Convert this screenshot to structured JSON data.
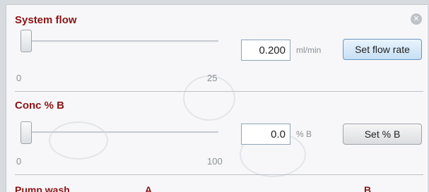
{
  "system_flow": {
    "title": "System flow",
    "value": "0.200",
    "unit": "ml/min",
    "button_label": "Set flow rate",
    "slider_min": "0",
    "slider_max": "25",
    "slider_fraction": 0
  },
  "conc_b": {
    "title": "Conc % B",
    "value": "0.0",
    "unit": "% B",
    "button_label": "Set % B",
    "slider_min": "0",
    "slider_max": "100",
    "slider_fraction": 0
  },
  "pump_wash": {
    "title": "Pump wash",
    "col_a": "A",
    "col_b": "B"
  },
  "close_icon": "close-icon",
  "colors": {
    "title_red": "#8b1414",
    "button_blue": "#c6dff4",
    "panel_bg": "#f8f8fa"
  }
}
